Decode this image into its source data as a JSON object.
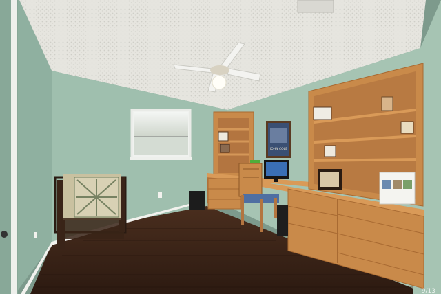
{
  "scene": {
    "description_tags": [
      "ceiling-fan",
      "window",
      "quilt-rack",
      "built-in-desk",
      "bookshelves",
      "wood-floor"
    ],
    "colors": {
      "wall": "#9fbfae",
      "wall_shadow": "#86a697",
      "ceiling": "#e8e7e2",
      "floor": "#3b2418",
      "wood": "#c98a4a",
      "wood_dark": "#a86a32",
      "trim": "#f2f2ee"
    }
  },
  "wall_poster": {
    "caption": "JOHN COLE"
  },
  "watermark": {
    "text": "9/13"
  }
}
